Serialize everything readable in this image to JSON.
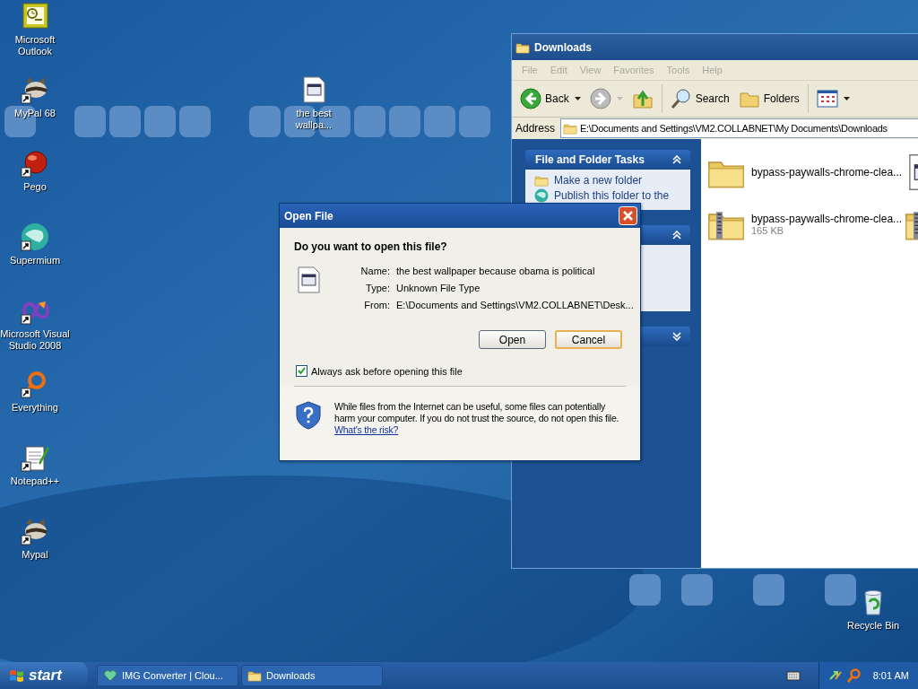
{
  "desktop_icons": [
    {
      "label": "Microsoft Outlook",
      "kind": "outlook",
      "shortcut": false
    },
    {
      "label": "MyPal 68",
      "kind": "raccoon",
      "shortcut": true
    },
    {
      "label": "Pego",
      "kind": "ball",
      "shortcut": true
    },
    {
      "label": "Supermium",
      "kind": "globe",
      "shortcut": true
    },
    {
      "label": "Microsoft Visual Studio 2008",
      "kind": "infinity",
      "shortcut": true
    },
    {
      "label": "Everything",
      "kind": "ring",
      "shortcut": true
    },
    {
      "label": "Notepad++",
      "kind": "notepad",
      "shortcut": true
    },
    {
      "label": "Mypal",
      "kind": "raccoon",
      "shortcut": true
    }
  ],
  "desktop_file": {
    "label": "the best wallpa...",
    "kind": "document"
  },
  "recycle_bin": {
    "label": "Recycle Bin"
  },
  "explorer": {
    "title": "Downloads",
    "menu": [
      "File",
      "Edit",
      "View",
      "Favorites",
      "Tools",
      "Help"
    ],
    "toolbar": [
      {
        "kind": "back",
        "label": "Back"
      },
      {
        "kind": "forward"
      },
      {
        "kind": "up"
      },
      {
        "kind": "search",
        "label": "Search"
      },
      {
        "kind": "folders",
        "label": "Folders"
      },
      {
        "kind": "views"
      }
    ],
    "address_label": "Address",
    "address": "E:\\Documents and Settings\\VM2.COLLABNET\\My Documents\\Downloads",
    "task_panels": [
      {
        "title": "File and Folder Tasks",
        "expanded": true,
        "items": [
          {
            "label": "Make a new folder",
            "kind": "folder"
          },
          {
            "label": "Publish this folder to the",
            "kind": "globe"
          }
        ]
      },
      {
        "expanded": true
      },
      {
        "expanded": false
      }
    ],
    "files": [
      {
        "kind": "folder",
        "name": "bypass-paywalls-chrome-clea..."
      },
      {
        "kind": "document"
      },
      {
        "kind": "zip",
        "name": "bypass-paywalls-chrome-clea...",
        "size": "165 KB"
      },
      {
        "kind": "zip"
      }
    ]
  },
  "dialog": {
    "title": "Open File",
    "question": "Do you want to open this file?",
    "fields": [
      {
        "label": "Name:",
        "value": "the best wallpaper because obama is political"
      },
      {
        "label": "Type:",
        "value": "Unknown File Type"
      },
      {
        "label": "From:",
        "value": "E:\\Documents and Settings\\VM2.COLLABNET\\Desk..."
      }
    ],
    "buttons": [
      {
        "label": "Open",
        "default": false
      },
      {
        "label": "Cancel",
        "default": true
      }
    ],
    "checkbox": {
      "label": "Always ask before opening this file",
      "checked": true
    },
    "warning": "While files from the Internet can be useful, some files can potentially harm your computer. If you do not trust the source, do not open this file.",
    "link": "What's the risk?"
  },
  "taskbar": {
    "start": "start",
    "tasks": [
      {
        "label": "IMG Converter | Clou...",
        "kind": "heart"
      },
      {
        "label": "Downloads",
        "kind": "folder"
      }
    ],
    "clock": "8:01 AM"
  }
}
